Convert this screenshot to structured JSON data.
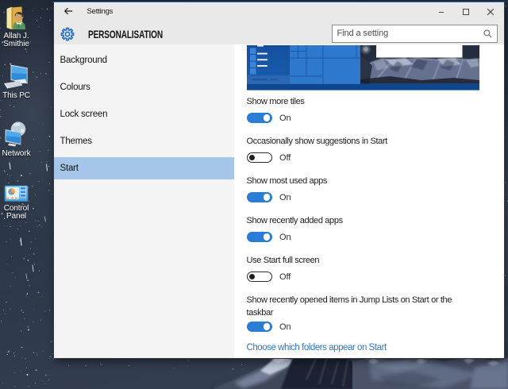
{
  "desktop": {
    "icons": [
      {
        "id": "user-folder",
        "label": "Allan J. Smithie"
      },
      {
        "id": "this-pc",
        "label": "This PC"
      },
      {
        "id": "network",
        "label": "Network"
      },
      {
        "id": "control-panel",
        "label": "Control Panel"
      }
    ]
  },
  "window": {
    "titlebar": {
      "title": "Settings"
    },
    "header": {
      "page_title": "PERSONALISATION",
      "search_placeholder": "Find a setting"
    },
    "sidebar": {
      "items": [
        {
          "label": "Background",
          "selected": false
        },
        {
          "label": "Colours",
          "selected": false
        },
        {
          "label": "Lock screen",
          "selected": false
        },
        {
          "label": "Themes",
          "selected": false
        },
        {
          "label": "Start",
          "selected": true
        }
      ]
    },
    "content": {
      "settings": [
        {
          "label": "Show more tiles",
          "on": true,
          "state": "On"
        },
        {
          "label": "Occasionally show suggestions in Start",
          "on": false,
          "state": "Off"
        },
        {
          "label": "Show most used apps",
          "on": true,
          "state": "On"
        },
        {
          "label": "Show recently added apps",
          "on": true,
          "state": "On"
        },
        {
          "label": "Use Start full screen",
          "on": false,
          "state": "Off"
        },
        {
          "label": "Show recently opened items in Jump Lists on Start or the\ntaskbar",
          "on": true,
          "state": "On"
        }
      ],
      "link": "Choose which folders appear on Start"
    }
  },
  "colors": {
    "accent": "#2a7cd4",
    "link": "#2677c9",
    "sidebar_selected": "#a5c6e8"
  }
}
